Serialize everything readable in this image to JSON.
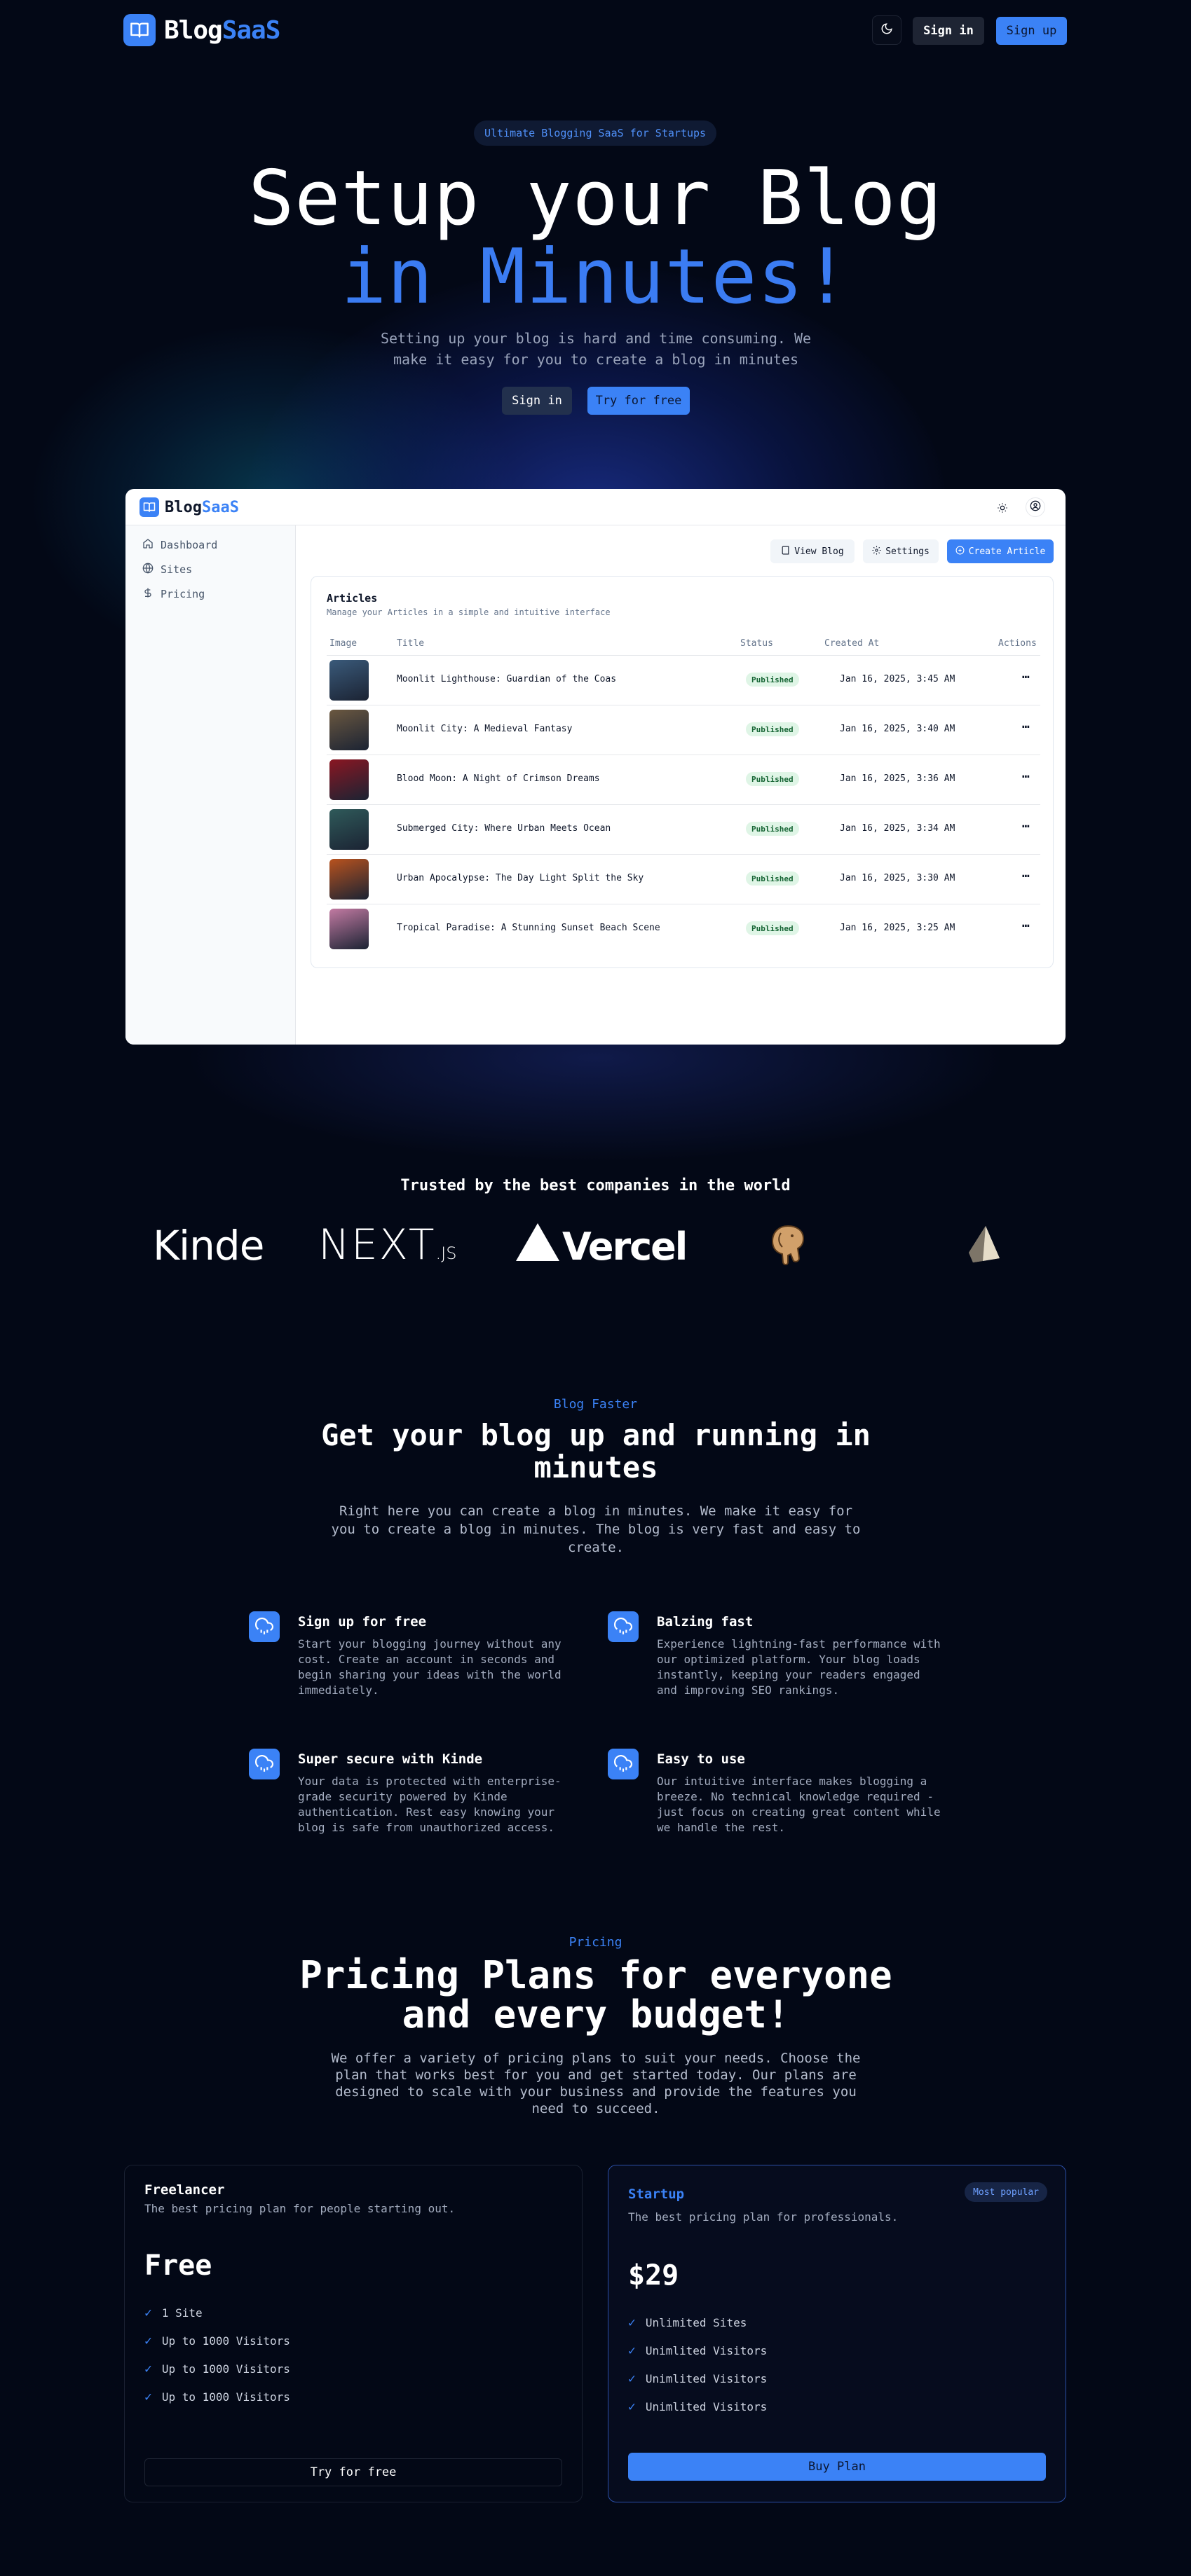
{
  "nav": {
    "logo_part1": "Blog",
    "logo_part2": "SaaS",
    "signin": "Sign in",
    "signup": "Sign up"
  },
  "hero": {
    "badge": "Ultimate Blogging SaaS for Startups",
    "title_line1": "Setup your Blog",
    "title_line2": "in Minutes!",
    "subtitle": "Setting up your blog is hard and time consuming. We make it easy for you to create a blog in minutes",
    "signin": "Sign in",
    "try": "Try for free"
  },
  "dashboard": {
    "logo_part1": "Blog",
    "logo_part2": "SaaS",
    "sidebar": [
      {
        "label": "Dashboard",
        "icon": "home-icon"
      },
      {
        "label": "Sites",
        "icon": "globe-icon"
      },
      {
        "label": "Pricing",
        "icon": "dollar-icon"
      }
    ],
    "buttons": {
      "view_blog": "View Blog",
      "settings": "Settings",
      "create": "Create Article"
    },
    "card_title": "Articles",
    "card_sub": "Manage your Articles in a simple and intuitive interface",
    "columns": [
      "Image",
      "Title",
      "Status",
      "Created At",
      "Actions"
    ],
    "rows": [
      {
        "title": "Moonlit Lighthouse: Guardian of the Coas",
        "status": "Published",
        "date": "Jan 16, 2025, 3:45 AM",
        "thumb": "#3a5a7a"
      },
      {
        "title": "Moonlit City: A Medieval Fantasy",
        "status": "Published",
        "date": "Jan 16, 2025, 3:40 AM",
        "thumb": "#6b5840"
      },
      {
        "title": "Blood Moon: A Night of Crimson Dreams",
        "status": "Published",
        "date": "Jan 16, 2025, 3:36 AM",
        "thumb": "#8a1622"
      },
      {
        "title": "Submerged City: Where Urban Meets Ocean",
        "status": "Published",
        "date": "Jan 16, 2025, 3:34 AM",
        "thumb": "#2f5a5a"
      },
      {
        "title": "Urban Apocalypse: The Day Light Split the Sky",
        "status": "Published",
        "date": "Jan 16, 2025, 3:30 AM",
        "thumb": "#b8521e"
      },
      {
        "title": "Tropical Paradise: A Stunning Sunset Beach Scene",
        "status": "Published",
        "date": "Jan 16, 2025, 3:25 AM",
        "thumb": "#c27aa2"
      }
    ]
  },
  "trusted": {
    "heading": "Trusted by the best companies in the world",
    "brands": {
      "kinde": "Kinde",
      "next_main": "NEXT",
      "next_sub": ".JS",
      "vercel": "Vercel"
    }
  },
  "features": {
    "eyebrow": "Blog Faster",
    "title": "Get your blog up and running in minutes",
    "subtitle": "Right here you can create a blog in minutes. We make it easy for you to create a blog in minutes. The blog is very fast and easy to create.",
    "items": [
      {
        "title": "Sign up for free",
        "desc": "Start your blogging journey without any cost. Create an account in seconds and begin sharing your ideas with the world immediately."
      },
      {
        "title": "Balzing fast",
        "desc": "Experience lightning-fast performance with our optimized platform. Your blog loads instantly, keeping your readers engaged and improving SEO rankings."
      },
      {
        "title": "Super secure with Kinde",
        "desc": "Your data is protected with enterprise-grade security powered by Kinde authentication. Rest easy knowing your blog is safe from unauthorized access."
      },
      {
        "title": "Easy to use",
        "desc": "Our intuitive interface makes blogging a breeze. No technical knowledge required - just focus on creating great content while we handle the rest."
      }
    ]
  },
  "pricing": {
    "eyebrow": "Pricing",
    "title": "Pricing Plans for everyone and every budget!",
    "subtitle": "We offer a variety of pricing plans to suit your needs. Choose the plan that works best for you and get started today. Our plans are designed to scale with your business and provide the features you need to succeed.",
    "plans": [
      {
        "name": "Freelancer",
        "desc": "The best pricing plan for people starting out.",
        "price": "Free",
        "features": [
          "1 Site",
          "Up to 1000 Visitors",
          "Up to 1000 Visitors",
          "Up to 1000 Visitors"
        ],
        "cta": "Try for free"
      },
      {
        "name": "Startup",
        "badge": "Most popular",
        "desc": "The best pricing plan for professionals.",
        "price": "$29",
        "features": [
          "Unlimited Sites",
          "Unimlited Visitors",
          "Unimlited Visitors",
          "Unimlited Visitors"
        ],
        "cta": "Buy Plan"
      }
    ]
  },
  "colors": {
    "background": "#030816",
    "accent": "#3b82f6",
    "published_badge": "#dff5e6"
  }
}
